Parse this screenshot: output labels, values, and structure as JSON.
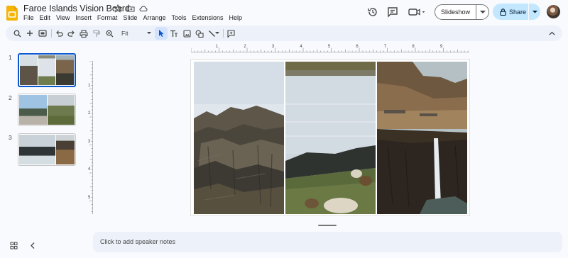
{
  "document": {
    "title": "Faroe Islands Vision Board"
  },
  "menu": [
    "File",
    "Edit",
    "View",
    "Insert",
    "Format",
    "Slide",
    "Arrange",
    "Tools",
    "Extensions",
    "Help"
  ],
  "header": {
    "slideshow_label": "Slideshow",
    "share_label": "Share"
  },
  "toolbar": {
    "zoom_value": "Fit"
  },
  "filmstrip": {
    "slides": [
      {
        "number": "1",
        "selected": true
      },
      {
        "number": "2",
        "selected": false
      },
      {
        "number": "3",
        "selected": false
      }
    ]
  },
  "ruler": {
    "horizontal": [
      "1",
      "2",
      "3",
      "4",
      "5",
      "6",
      "7",
      "8",
      "9"
    ],
    "vertical": [
      "1",
      "2",
      "3",
      "4",
      "5"
    ]
  },
  "notes": {
    "placeholder": "Click to add speaker notes"
  },
  "colors": {
    "accent": "#0b57d0",
    "share_bg": "#c2e7ff",
    "toolbar_bg": "#edf2fa",
    "slides_logo": "#f4b400"
  }
}
